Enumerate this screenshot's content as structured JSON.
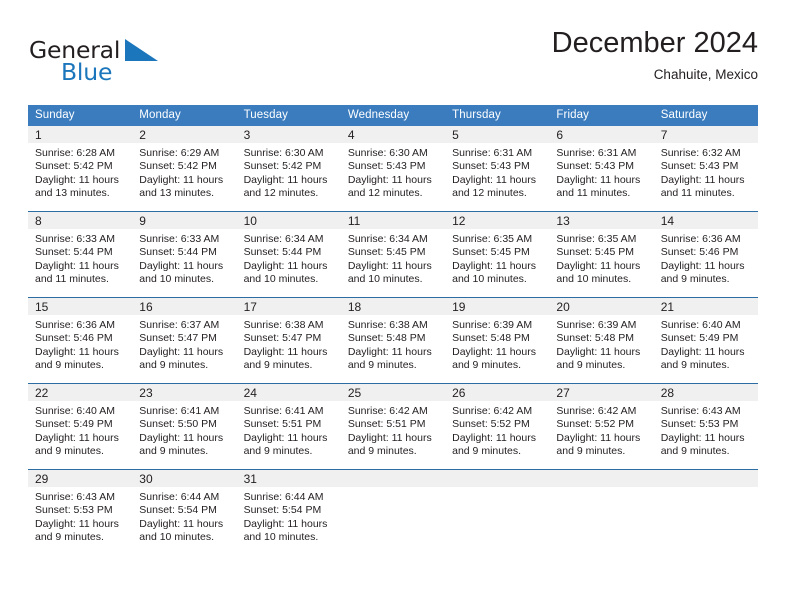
{
  "brand": {
    "word1": "General",
    "word2": "Blue",
    "triangle_color": "#1b76bc"
  },
  "header": {
    "title": "December 2024",
    "subtitle": "Chahuite, Mexico"
  },
  "theme": {
    "header_bg": "#3a7cbe",
    "header_text": "#ffffff",
    "row_divider": "#2e6da4",
    "daynum_bg": "#f0f0f0",
    "body_text": "#231f20"
  },
  "weekday_headers": [
    "Sunday",
    "Monday",
    "Tuesday",
    "Wednesday",
    "Thursday",
    "Friday",
    "Saturday"
  ],
  "labels": {
    "sunrise_prefix": "Sunrise: ",
    "sunset_prefix": "Sunset: ",
    "daylight_prefix": "Daylight: "
  },
  "weeks": [
    [
      {
        "day": "1",
        "sunrise": "Sunrise: 6:28 AM",
        "sunset": "Sunset: 5:42 PM",
        "daylight_line1": "Daylight: 11 hours",
        "daylight_line2": "and 13 minutes."
      },
      {
        "day": "2",
        "sunrise": "Sunrise: 6:29 AM",
        "sunset": "Sunset: 5:42 PM",
        "daylight_line1": "Daylight: 11 hours",
        "daylight_line2": "and 13 minutes."
      },
      {
        "day": "3",
        "sunrise": "Sunrise: 6:30 AM",
        "sunset": "Sunset: 5:42 PM",
        "daylight_line1": "Daylight: 11 hours",
        "daylight_line2": "and 12 minutes."
      },
      {
        "day": "4",
        "sunrise": "Sunrise: 6:30 AM",
        "sunset": "Sunset: 5:43 PM",
        "daylight_line1": "Daylight: 11 hours",
        "daylight_line2": "and 12 minutes."
      },
      {
        "day": "5",
        "sunrise": "Sunrise: 6:31 AM",
        "sunset": "Sunset: 5:43 PM",
        "daylight_line1": "Daylight: 11 hours",
        "daylight_line2": "and 12 minutes."
      },
      {
        "day": "6",
        "sunrise": "Sunrise: 6:31 AM",
        "sunset": "Sunset: 5:43 PM",
        "daylight_line1": "Daylight: 11 hours",
        "daylight_line2": "and 11 minutes."
      },
      {
        "day": "7",
        "sunrise": "Sunrise: 6:32 AM",
        "sunset": "Sunset: 5:43 PM",
        "daylight_line1": "Daylight: 11 hours",
        "daylight_line2": "and 11 minutes."
      }
    ],
    [
      {
        "day": "8",
        "sunrise": "Sunrise: 6:33 AM",
        "sunset": "Sunset: 5:44 PM",
        "daylight_line1": "Daylight: 11 hours",
        "daylight_line2": "and 11 minutes."
      },
      {
        "day": "9",
        "sunrise": "Sunrise: 6:33 AM",
        "sunset": "Sunset: 5:44 PM",
        "daylight_line1": "Daylight: 11 hours",
        "daylight_line2": "and 10 minutes."
      },
      {
        "day": "10",
        "sunrise": "Sunrise: 6:34 AM",
        "sunset": "Sunset: 5:44 PM",
        "daylight_line1": "Daylight: 11 hours",
        "daylight_line2": "and 10 minutes."
      },
      {
        "day": "11",
        "sunrise": "Sunrise: 6:34 AM",
        "sunset": "Sunset: 5:45 PM",
        "daylight_line1": "Daylight: 11 hours",
        "daylight_line2": "and 10 minutes."
      },
      {
        "day": "12",
        "sunrise": "Sunrise: 6:35 AM",
        "sunset": "Sunset: 5:45 PM",
        "daylight_line1": "Daylight: 11 hours",
        "daylight_line2": "and 10 minutes."
      },
      {
        "day": "13",
        "sunrise": "Sunrise: 6:35 AM",
        "sunset": "Sunset: 5:45 PM",
        "daylight_line1": "Daylight: 11 hours",
        "daylight_line2": "and 10 minutes."
      },
      {
        "day": "14",
        "sunrise": "Sunrise: 6:36 AM",
        "sunset": "Sunset: 5:46 PM",
        "daylight_line1": "Daylight: 11 hours",
        "daylight_line2": "and 9 minutes."
      }
    ],
    [
      {
        "day": "15",
        "sunrise": "Sunrise: 6:36 AM",
        "sunset": "Sunset: 5:46 PM",
        "daylight_line1": "Daylight: 11 hours",
        "daylight_line2": "and 9 minutes."
      },
      {
        "day": "16",
        "sunrise": "Sunrise: 6:37 AM",
        "sunset": "Sunset: 5:47 PM",
        "daylight_line1": "Daylight: 11 hours",
        "daylight_line2": "and 9 minutes."
      },
      {
        "day": "17",
        "sunrise": "Sunrise: 6:38 AM",
        "sunset": "Sunset: 5:47 PM",
        "daylight_line1": "Daylight: 11 hours",
        "daylight_line2": "and 9 minutes."
      },
      {
        "day": "18",
        "sunrise": "Sunrise: 6:38 AM",
        "sunset": "Sunset: 5:48 PM",
        "daylight_line1": "Daylight: 11 hours",
        "daylight_line2": "and 9 minutes."
      },
      {
        "day": "19",
        "sunrise": "Sunrise: 6:39 AM",
        "sunset": "Sunset: 5:48 PM",
        "daylight_line1": "Daylight: 11 hours",
        "daylight_line2": "and 9 minutes."
      },
      {
        "day": "20",
        "sunrise": "Sunrise: 6:39 AM",
        "sunset": "Sunset: 5:48 PM",
        "daylight_line1": "Daylight: 11 hours",
        "daylight_line2": "and 9 minutes."
      },
      {
        "day": "21",
        "sunrise": "Sunrise: 6:40 AM",
        "sunset": "Sunset: 5:49 PM",
        "daylight_line1": "Daylight: 11 hours",
        "daylight_line2": "and 9 minutes."
      }
    ],
    [
      {
        "day": "22",
        "sunrise": "Sunrise: 6:40 AM",
        "sunset": "Sunset: 5:49 PM",
        "daylight_line1": "Daylight: 11 hours",
        "daylight_line2": "and 9 minutes."
      },
      {
        "day": "23",
        "sunrise": "Sunrise: 6:41 AM",
        "sunset": "Sunset: 5:50 PM",
        "daylight_line1": "Daylight: 11 hours",
        "daylight_line2": "and 9 minutes."
      },
      {
        "day": "24",
        "sunrise": "Sunrise: 6:41 AM",
        "sunset": "Sunset: 5:51 PM",
        "daylight_line1": "Daylight: 11 hours",
        "daylight_line2": "and 9 minutes."
      },
      {
        "day": "25",
        "sunrise": "Sunrise: 6:42 AM",
        "sunset": "Sunset: 5:51 PM",
        "daylight_line1": "Daylight: 11 hours",
        "daylight_line2": "and 9 minutes."
      },
      {
        "day": "26",
        "sunrise": "Sunrise: 6:42 AM",
        "sunset": "Sunset: 5:52 PM",
        "daylight_line1": "Daylight: 11 hours",
        "daylight_line2": "and 9 minutes."
      },
      {
        "day": "27",
        "sunrise": "Sunrise: 6:42 AM",
        "sunset": "Sunset: 5:52 PM",
        "daylight_line1": "Daylight: 11 hours",
        "daylight_line2": "and 9 minutes."
      },
      {
        "day": "28",
        "sunrise": "Sunrise: 6:43 AM",
        "sunset": "Sunset: 5:53 PM",
        "daylight_line1": "Daylight: 11 hours",
        "daylight_line2": "and 9 minutes."
      }
    ],
    [
      {
        "day": "29",
        "sunrise": "Sunrise: 6:43 AM",
        "sunset": "Sunset: 5:53 PM",
        "daylight_line1": "Daylight: 11 hours",
        "daylight_line2": "and 9 minutes."
      },
      {
        "day": "30",
        "sunrise": "Sunrise: 6:44 AM",
        "sunset": "Sunset: 5:54 PM",
        "daylight_line1": "Daylight: 11 hours",
        "daylight_line2": "and 10 minutes."
      },
      {
        "day": "31",
        "sunrise": "Sunrise: 6:44 AM",
        "sunset": "Sunset: 5:54 PM",
        "daylight_line1": "Daylight: 11 hours",
        "daylight_line2": "and 10 minutes."
      },
      {
        "day": "",
        "sunrise": "",
        "sunset": "",
        "daylight_line1": "",
        "daylight_line2": ""
      },
      {
        "day": "",
        "sunrise": "",
        "sunset": "",
        "daylight_line1": "",
        "daylight_line2": ""
      },
      {
        "day": "",
        "sunrise": "",
        "sunset": "",
        "daylight_line1": "",
        "daylight_line2": ""
      },
      {
        "day": "",
        "sunrise": "",
        "sunset": "",
        "daylight_line1": "",
        "daylight_line2": ""
      }
    ]
  ]
}
